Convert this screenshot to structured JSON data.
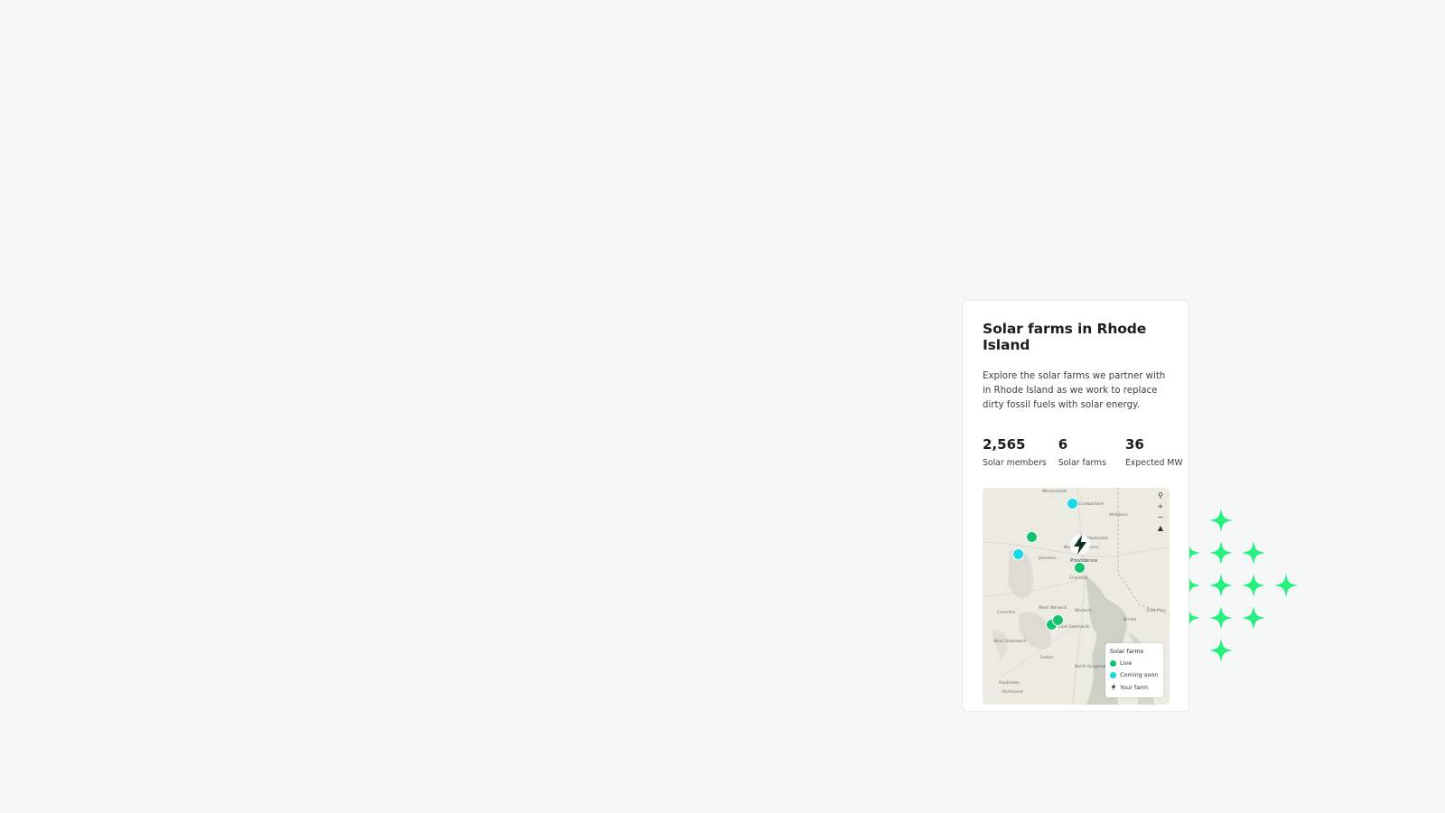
{
  "card": {
    "title": "Solar farms in Rhode Island",
    "description": "Explore the solar farms we partner with in Rhode Island as we work to replace dirty fossil fuels with solar energy.",
    "stats": [
      {
        "value": "2,565",
        "label": "Solar members"
      },
      {
        "value": "6",
        "label": "Solar farms"
      },
      {
        "value": "36",
        "label": "Expected MW"
      }
    ]
  },
  "map": {
    "controls": [
      "search-icon",
      "zoom-in",
      "zoom-out",
      "compass"
    ],
    "places": [
      "Woonsocket",
      "Cumberland",
      "Attleboro",
      "Pawtucket",
      "North Providence",
      "Providence",
      "Johnston",
      "Cranston",
      "West Warwick",
      "Warwick",
      "Coventry",
      "East Greenwich",
      "West Greenwich",
      "Exeter",
      "North Kingstown",
      "Bristol",
      "East Prov",
      "Hopkinton",
      "Richmond"
    ],
    "legend": {
      "title": "Solar farms",
      "items": [
        {
          "label": "Live",
          "color": "#10c46e"
        },
        {
          "label": "Coming soon",
          "color": "#17d8e6"
        },
        {
          "label": "Your farm",
          "icon": "bolt-icon"
        }
      ]
    }
  },
  "colors": {
    "live": "#10c46e",
    "coming_soon": "#17d8e6",
    "sparkle": "#27f07f",
    "bolt": "#0f2e22"
  }
}
